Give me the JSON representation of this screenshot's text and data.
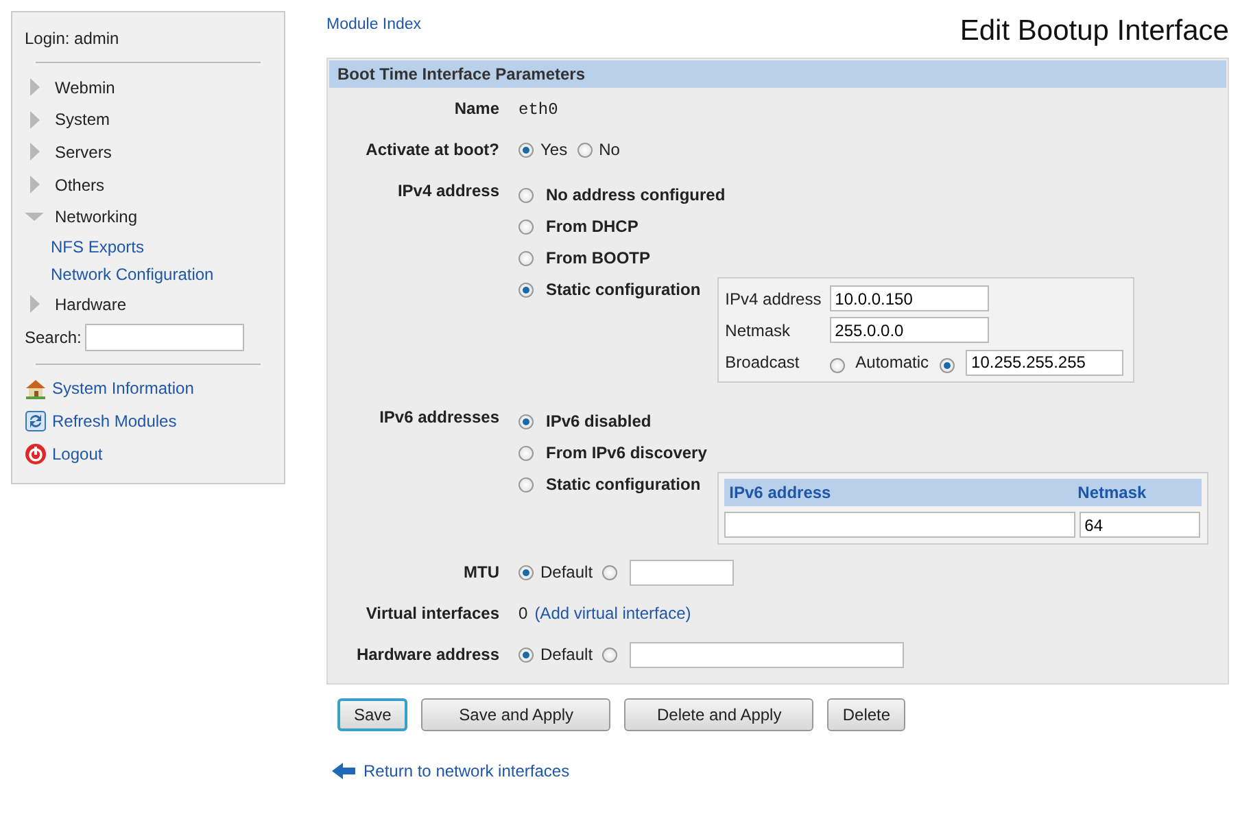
{
  "sidebar": {
    "login": "Login: admin",
    "categories": [
      {
        "label": "Webmin",
        "expanded": false
      },
      {
        "label": "System",
        "expanded": false
      },
      {
        "label": "Servers",
        "expanded": false
      },
      {
        "label": "Others",
        "expanded": false
      },
      {
        "label": "Networking",
        "expanded": true,
        "children": [
          {
            "label": "NFS Exports"
          },
          {
            "label": "Network Configuration"
          }
        ]
      },
      {
        "label": "Hardware",
        "expanded": false
      }
    ],
    "search_label": "Search:",
    "links": [
      {
        "label": "System Information",
        "kind": "home"
      },
      {
        "label": "Refresh Modules",
        "kind": "refresh"
      },
      {
        "label": "Logout",
        "kind": "logout"
      }
    ]
  },
  "module_index": "Module Index",
  "title": "Edit Bootup Interface",
  "section_title": "Boot Time Interface Parameters",
  "rows": [
    {
      "kind": "text",
      "label": "Name",
      "value": "eth0"
    },
    {
      "kind": "inline",
      "label": "Activate at boot?",
      "options": [
        {
          "kind": "text",
          "label": "Yes",
          "selected": true
        },
        {
          "kind": "text",
          "label": "No",
          "selected": false
        }
      ]
    },
    {
      "kind": "ipv4",
      "label": "IPv4 address",
      "options": [
        {
          "label": "No address configured",
          "selected": false
        },
        {
          "label": "From DHCP",
          "selected": false
        },
        {
          "label": "From BOOTP",
          "selected": false
        },
        {
          "label": "Static configuration",
          "selected": true
        }
      ],
      "static": {
        "address_label": "IPv4 address",
        "address": "10.0.0.150",
        "netmask_label": "Netmask",
        "netmask": "255.0.0.0",
        "broadcast_label": "Broadcast",
        "broadcast_options": [
          {
            "kind": "text",
            "label": "Automatic",
            "selected": false
          },
          {
            "kind": "field",
            "value": "10.255.255.255",
            "selected": true
          }
        ]
      }
    },
    {
      "kind": "ipv6",
      "label": "IPv6 addresses",
      "options": [
        {
          "label": "IPv6 disabled",
          "selected": true
        },
        {
          "label": "From IPv6 discovery",
          "selected": false
        },
        {
          "label": "Static configuration",
          "selected": false
        }
      ],
      "table": {
        "columns": [
          "IPv6 address",
          "Netmask"
        ],
        "rows": [
          {
            "netmask": "64"
          }
        ]
      }
    },
    {
      "kind": "inline",
      "label": "MTU",
      "options": [
        {
          "kind": "text",
          "label": "Default",
          "selected": true
        },
        {
          "kind": "field",
          "selected": false
        }
      ]
    },
    {
      "kind": "link",
      "label": "Virtual interfaces",
      "value": "0",
      "link": "(Add virtual interface)"
    },
    {
      "kind": "inline",
      "label": "Hardware address",
      "options": [
        {
          "kind": "text",
          "label": "Default",
          "selected": true
        },
        {
          "kind": "wide_field",
          "selected": false
        }
      ]
    }
  ],
  "buttons": [
    {
      "label": "Save",
      "focused": true
    },
    {
      "label": "Save and Apply",
      "focused": false
    },
    {
      "label": "Delete and Apply",
      "focused": false
    },
    {
      "label": "Delete",
      "focused": false
    }
  ],
  "return_link": "Return to network interfaces"
}
